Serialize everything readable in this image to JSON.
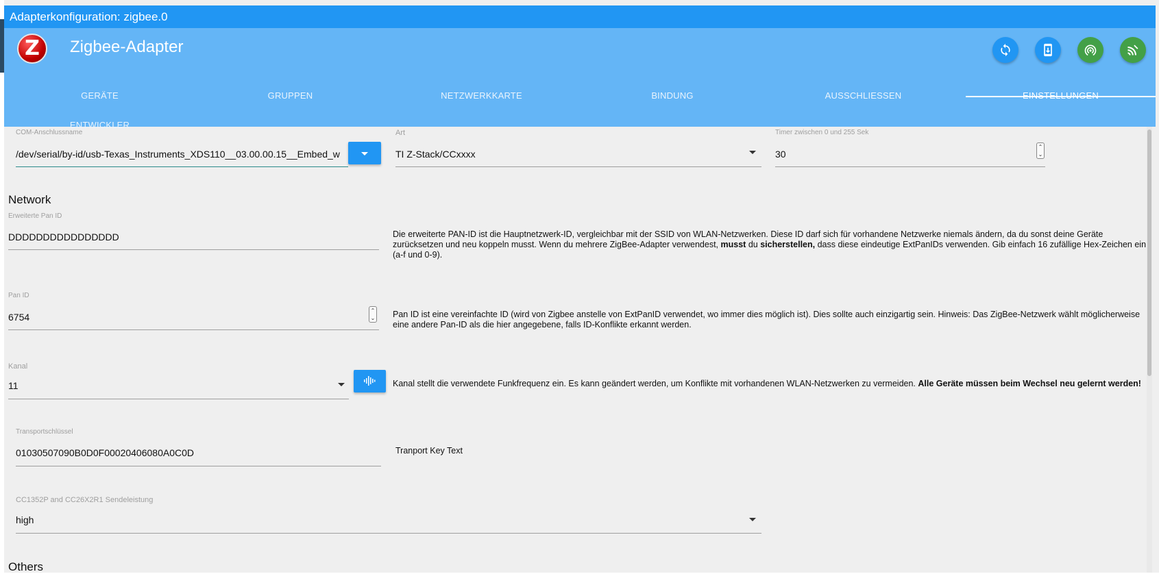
{
  "window": {
    "title": "Adapterkonfiguration: zigbee.0"
  },
  "app": {
    "title": "Zigbee-Adapter",
    "logo_icon": "zigbee-logo",
    "actions": [
      {
        "icon": "refresh-icon",
        "color": "#2196f3"
      },
      {
        "icon": "download-device-icon",
        "color": "#2196f3"
      },
      {
        "icon": "wifi-pairing-icon",
        "color": "#43a047"
      },
      {
        "icon": "signal-scan-icon",
        "color": "#43a047"
      }
    ]
  },
  "tabs": [
    {
      "label": "GERÄTE"
    },
    {
      "label": "GRUPPEN"
    },
    {
      "label": "NETZWERKKARTE"
    },
    {
      "label": "BINDUNG"
    },
    {
      "label": "AUSSCHLIESSEN"
    },
    {
      "label": "EINSTELLUNGEN",
      "active": true
    },
    {
      "label": "ENTWICKLER"
    }
  ],
  "settings": {
    "com_port": {
      "label": "COM-Anschlussname",
      "value": "/dev/serial/by-id/usb-Texas_Instruments_XDS110__03.00.00.15__Embed_w"
    },
    "type": {
      "label": "Art",
      "value": "TI Z-Stack/CCxxxx"
    },
    "timer": {
      "label": "Timer zwischen 0 und 255 Sek",
      "value": "30"
    }
  },
  "network": {
    "heading": "Network",
    "ext_pan_id": {
      "label": "Erweiterte Pan ID",
      "value": "DDDDDDDDDDDDDDDD",
      "desc_1": "Die erweiterte PAN-ID ist die Hauptnetzwerk-ID, vergleichbar mit der SSID von WLAN-Netzwerken. Diese ID darf sich für vorhandene Netzwerke niemals ändern, da du sonst deine Geräte zurücksetzen und neu koppeln musst. Wenn du mehrere ZigBee-Adapter verwendest, ",
      "desc_bold_1": "musst",
      "desc_2": " du ",
      "desc_bold_2": "sicherstellen,",
      "desc_3": " dass diese eindeutige ExtPanIDs verwenden. Gib einfach 16 zufällige Hex-Zeichen ein (a-f und 0-9)."
    },
    "pan_id": {
      "label": "Pan ID",
      "value": "6754",
      "desc": "Pan ID ist eine vereinfachte ID (wird von Zigbee anstelle von ExtPanID verwendet, wo immer dies möglich ist). Dies sollte auch einzigartig sein. Hinweis: Das ZigBee-Netzwerk wählt möglicherweise eine andere Pan-ID als die hier angegebene, falls ID-Konflikte erkannt werden."
    },
    "channel": {
      "label": "Kanal",
      "value": "11",
      "desc": "Kanal stellt die verwendete Funkfrequenz ein. Es kann geändert werden, um Konflikte mit vorhandenen WLAN-Netzwerken zu vermeiden. ",
      "desc_bold": "Alle Geräte müssen beim Wechsel neu gelernt werden!"
    },
    "transport_key": {
      "label": "Transportschlüssel",
      "value": "01030507090B0D0F00020406080A0C0D",
      "desc": "Tranport Key Text"
    },
    "tx_power": {
      "label": "CC1352P and CC26X2R1 Sendeleistung",
      "value": "high"
    }
  },
  "others": {
    "heading": "Others"
  }
}
